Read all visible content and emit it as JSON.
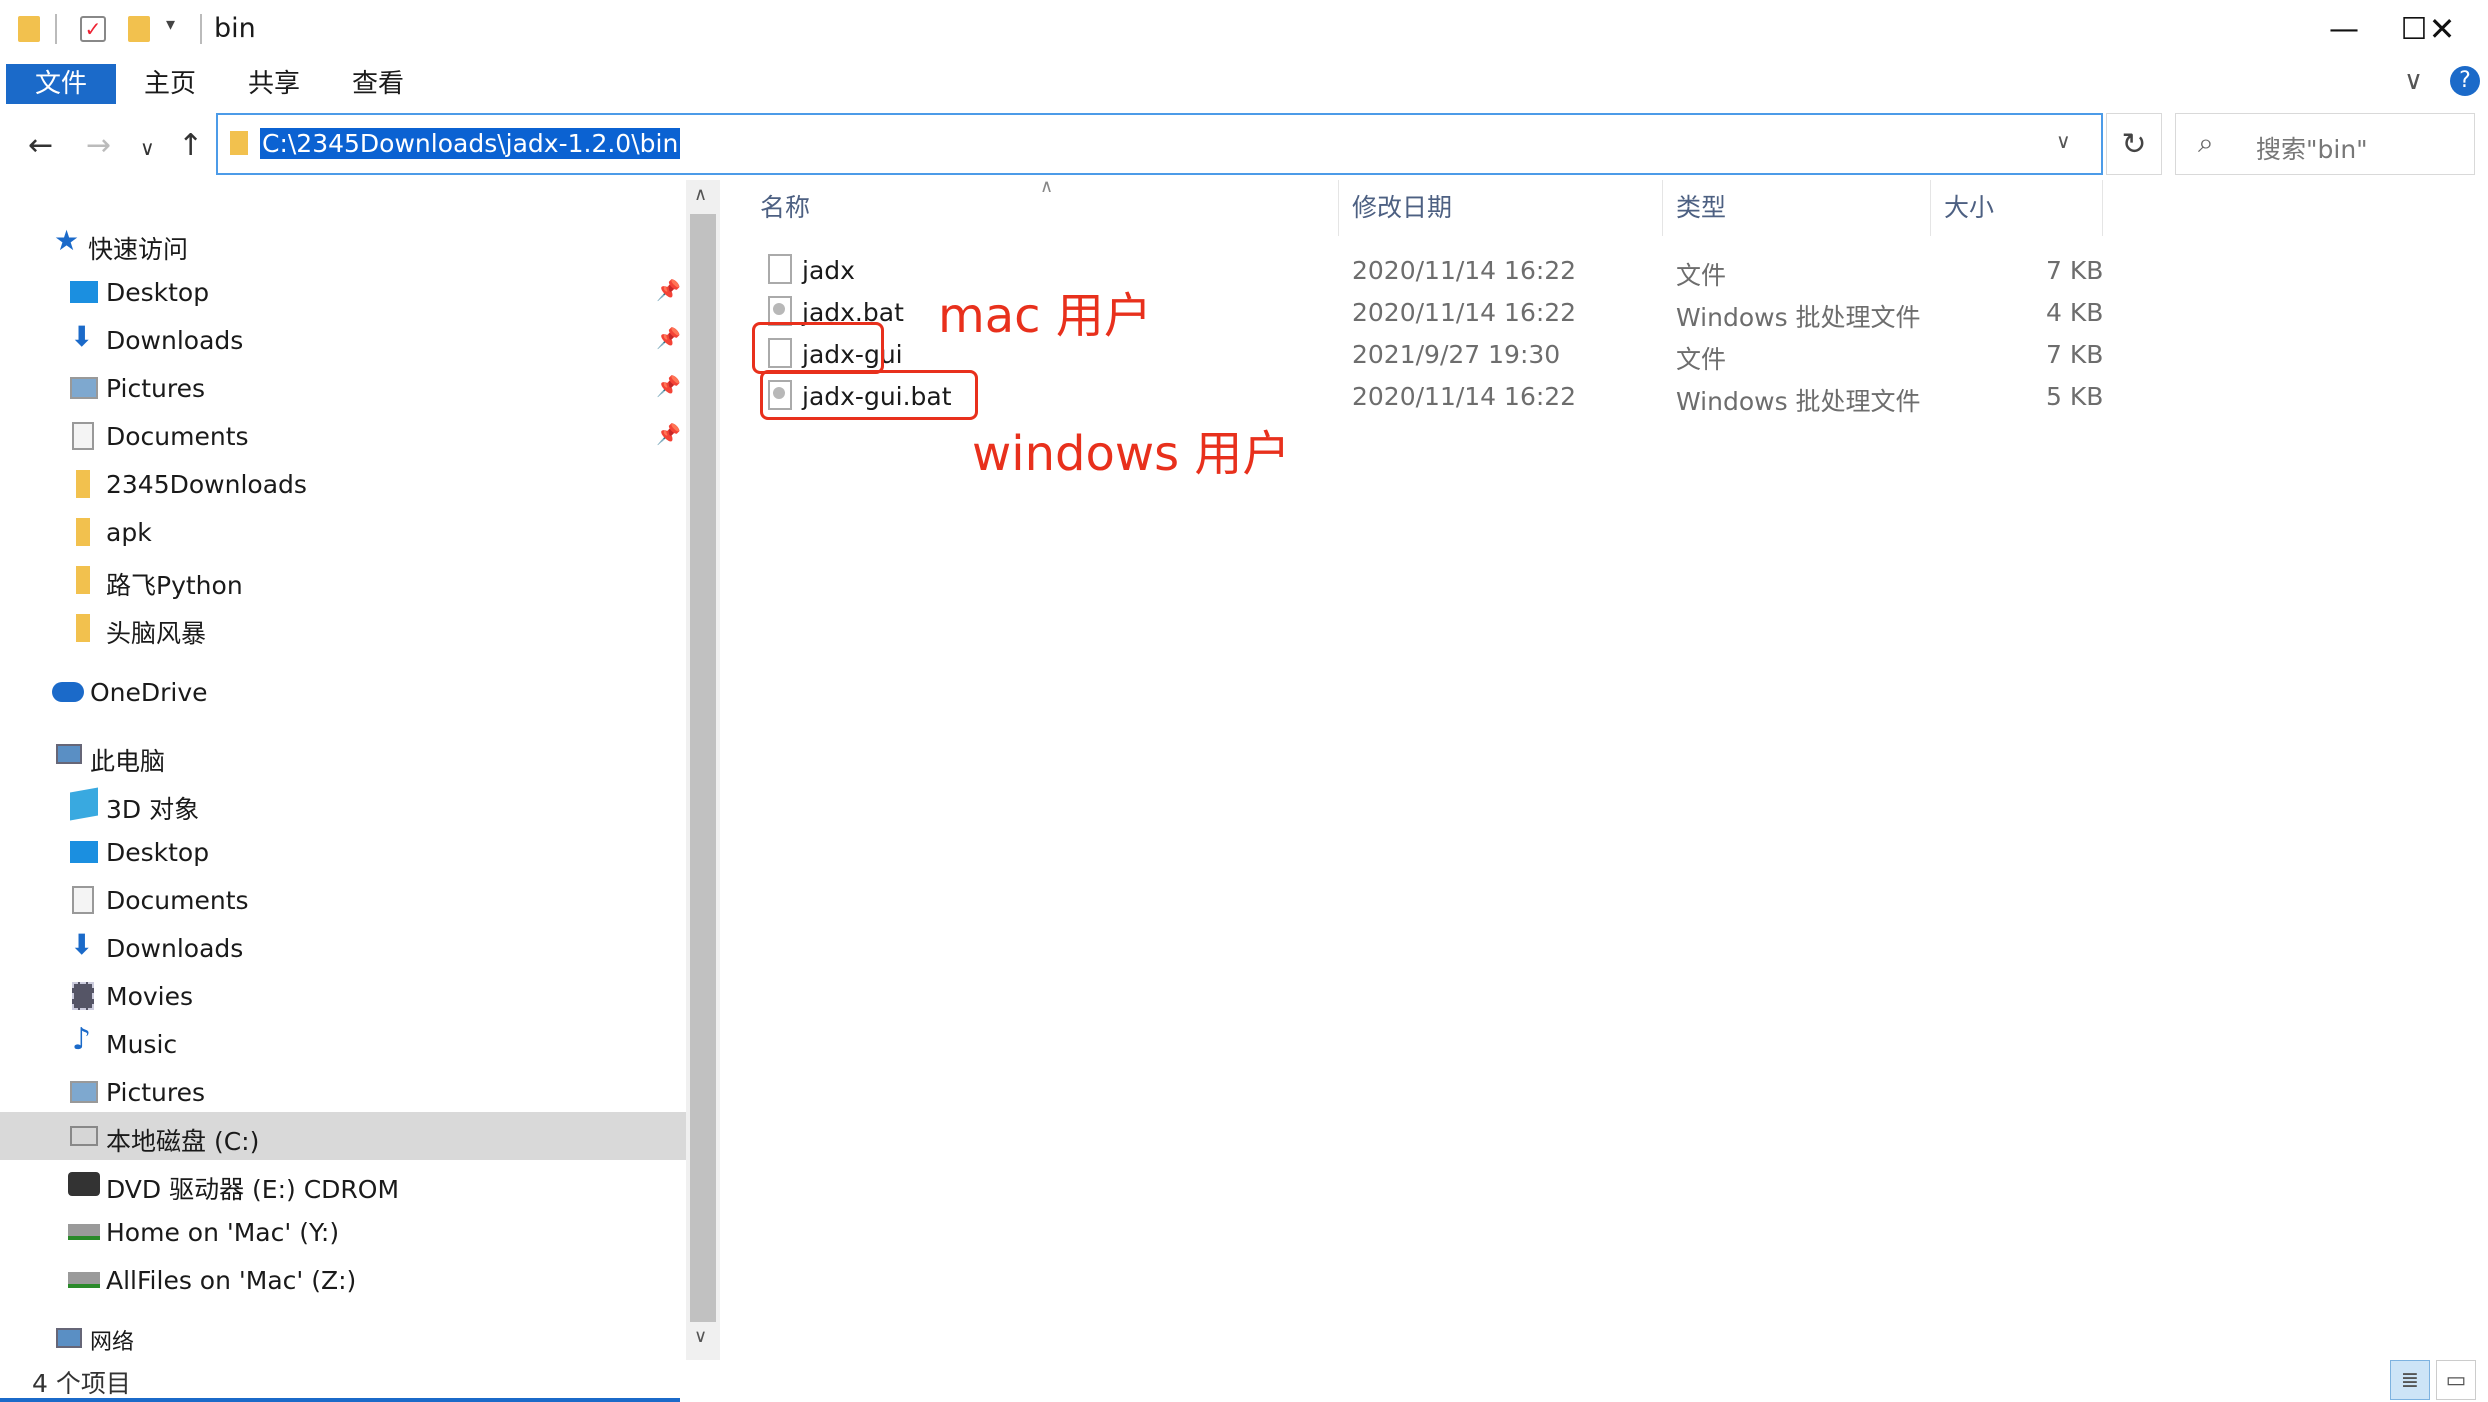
{
  "window": {
    "title": "bin"
  },
  "ribbon": {
    "tabs": [
      "文件",
      "主页",
      "共享",
      "查看"
    ],
    "help": "?"
  },
  "address": {
    "path": "C:\\2345Downloads\\jadx-1.2.0\\bin",
    "search_placeholder": "搜索\"bin\""
  },
  "sidebar": {
    "quick_access": "快速访问",
    "quick_items": [
      "Desktop",
      "Downloads",
      "Pictures",
      "Documents",
      "2345Downloads",
      "apk",
      "路飞Python",
      "头脑风暴"
    ],
    "onedrive": "OneDrive",
    "this_pc": "此电脑",
    "pc_items": [
      "3D 对象",
      "Desktop",
      "Documents",
      "Downloads",
      "Movies",
      "Music",
      "Pictures",
      "本地磁盘 (C:)",
      "DVD 驱动器 (E:) CDROM",
      "Home on 'Mac' (Y:)",
      "AllFiles on 'Mac' (Z:)"
    ],
    "network": "网络"
  },
  "columns": {
    "name": "名称",
    "modified": "修改日期",
    "type": "类型",
    "size": "大小"
  },
  "files": [
    {
      "name": "jadx",
      "modified": "2020/11/14 16:22",
      "type": "文件",
      "size": "7 KB"
    },
    {
      "name": "jadx.bat",
      "modified": "2020/11/14 16:22",
      "type": "Windows 批处理文件",
      "size": "4 KB"
    },
    {
      "name": "jadx-gui",
      "modified": "2021/9/27 19:30",
      "type": "文件",
      "size": "7 KB"
    },
    {
      "name": "jadx-gui.bat",
      "modified": "2020/11/14 16:22",
      "type": "Windows 批处理文件",
      "size": "5 KB"
    }
  ],
  "annotations": {
    "mac": "mac 用户",
    "windows": "windows 用户"
  },
  "status": {
    "count": "4 个项目"
  },
  "colors": {
    "accent": "#1b6ac9",
    "annotation": "#e8301c",
    "selection": "#0b62d2"
  }
}
